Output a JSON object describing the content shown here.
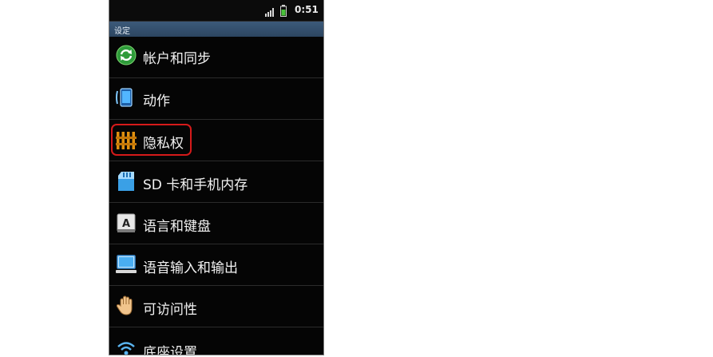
{
  "status_bar": {
    "time": "0:51"
  },
  "title": "设定",
  "menu": [
    {
      "label": "帐户和同步",
      "icon": "sync-icon"
    },
    {
      "label": "动作",
      "icon": "phone-motion-icon"
    },
    {
      "label": "隐私权",
      "icon": "privacy-fence-icon",
      "highlighted": true
    },
    {
      "label": "SD 卡和手机内存",
      "icon": "sd-card-icon"
    },
    {
      "label": "语言和键盘",
      "icon": "keyboard-letter-icon"
    },
    {
      "label": "语音输入和输出",
      "icon": "voice-monitor-icon"
    },
    {
      "label": "可访问性",
      "icon": "accessibility-hand-icon"
    },
    {
      "label": "底座设置",
      "icon": "dock-wifi-icon"
    }
  ],
  "colors": {
    "highlight_border": "#d51a1a",
    "title_bar": "#3c5a7a"
  }
}
